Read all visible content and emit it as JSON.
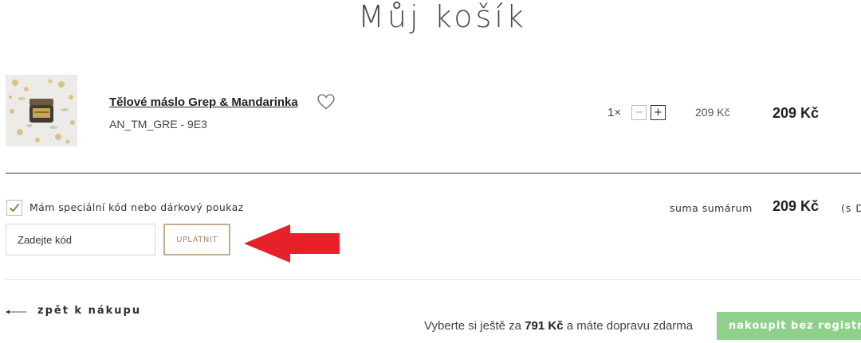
{
  "page": {
    "title": "Můj košík"
  },
  "cart": {
    "item": {
      "name": "Tělové máslo Grep & Mandarinka",
      "code": "AN_TM_GRE - 9E3",
      "quantity_label": "1×",
      "minus_label": "−",
      "plus_label": "+",
      "unit_price": "209 Kč",
      "line_total": "209 Kč"
    }
  },
  "coupon": {
    "checkbox_label": "Mám speciální kód nebo dárkový poukaz",
    "checked": true,
    "input_placeholder": "Zadejte kód",
    "apply_label": "UPLATNIT"
  },
  "summary": {
    "label": "suma sumárum",
    "value": "209 Kč",
    "note": "(s DPH)"
  },
  "footer": {
    "back_label": "zpět k nákupu",
    "shipping_prefix": "Vyberte si ještě za",
    "shipping_amount": "791 Kč",
    "shipping_suffix": "a máte dopravu zdarma",
    "checkout_label": "nakoupit bez registrace"
  },
  "icons": {
    "wishlist": "heart-icon",
    "checkbox": "checkmark-icon",
    "back": "arrow-left-icon",
    "annotation": "red-arrow-icon"
  },
  "colors": {
    "checkout_green": "#8fd18b",
    "apply_gold": "#c2ad8c",
    "checkmark_green": "#5f9a3a",
    "annotation_red": "#e8202a"
  }
}
